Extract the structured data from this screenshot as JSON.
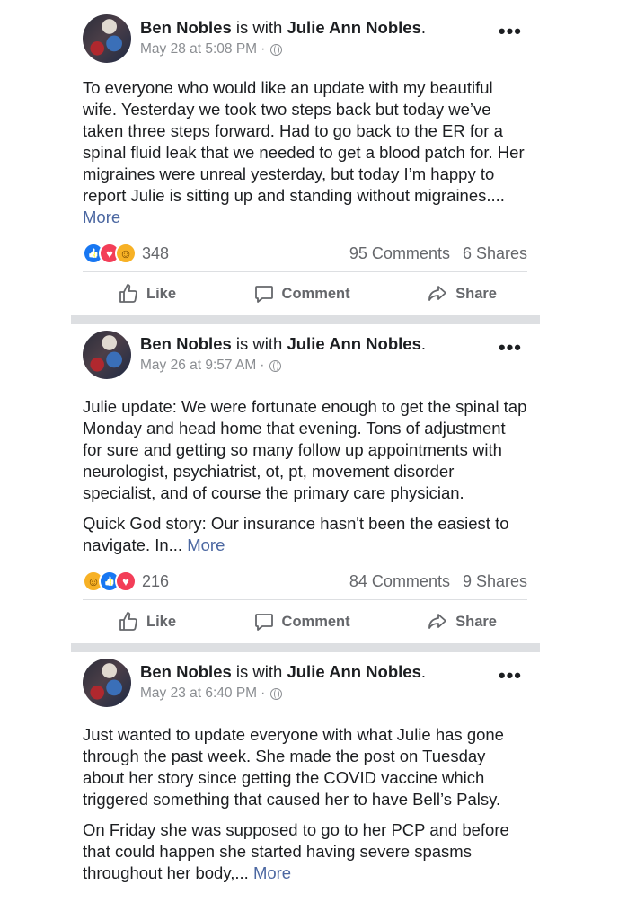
{
  "posts": [
    {
      "author": "Ben Nobles",
      "with_text": "is with",
      "tagged": "Julie Ann Nobles",
      "date": "May 28 at 5:08 PM",
      "paragraphs": [
        "To everyone who would like an update with my beautiful wife. Yesterday we took two steps back but today we’ve taken three steps forward. Had to go back to the ER for a spinal fluid leak that we needed to get a blood patch for. Her migraines were unreal yesterday, but today I’m happy to report Julie is sitting up and standing without migraines...."
      ],
      "more": "More",
      "reactions": [
        "like-icon",
        "love-icon",
        "care-icon"
      ],
      "reaction_count": "348",
      "comments": "95 Comments",
      "shares": "6 Shares"
    },
    {
      "author": "Ben Nobles",
      "with_text": "is with",
      "tagged": "Julie Ann Nobles",
      "date": "May 26 at 9:57 AM",
      "paragraphs": [
        "Julie update: We were fortunate enough to get the spinal tap Monday and head home that evening. Tons of adjustment for sure and getting so many follow up appointments with neurologist, psychiatrist, ot, pt, movement disorder specialist, and of course the primary care physician.",
        "Quick God story: Our insurance hasn't been the easiest to navigate. In..."
      ],
      "more": "More",
      "reactions": [
        "care-icon",
        "like-icon",
        "love-icon"
      ],
      "reaction_count": "216",
      "comments": "84 Comments",
      "shares": "9 Shares"
    },
    {
      "author": "Ben Nobles",
      "with_text": "is with",
      "tagged": "Julie Ann Nobles",
      "date": "May 23 at 6:40 PM",
      "paragraphs": [
        "Just wanted to update everyone with what Julie has gone through the past week. She made the post on Tuesday about her story since getting the COVID vaccine which triggered something that caused her to have Bell’s Palsy.",
        "On Friday she was supposed to go to her PCP and before that could happen she started having severe spasms throughout her body,..."
      ],
      "more": "More"
    }
  ],
  "actions": {
    "like": "Like",
    "comment": "Comment",
    "share": "Share"
  },
  "colors": {
    "link": "#4b67a1",
    "like": "#1877f2",
    "love": "#f33e58",
    "care": "#f7b125"
  }
}
